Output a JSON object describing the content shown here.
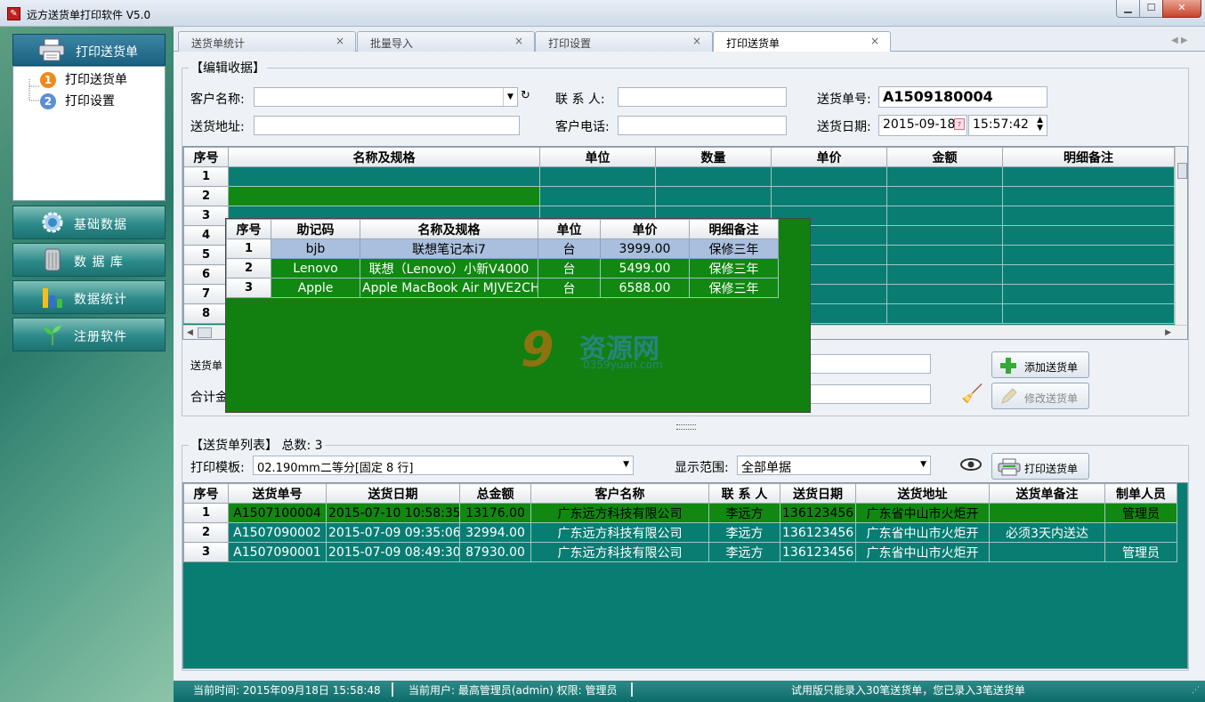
{
  "window": {
    "title": "远方送货单打印软件 V5.0",
    "icon": "app-icon"
  },
  "sidebar": {
    "header": {
      "label": "打印送货单",
      "icon": "printer-icon"
    },
    "tree": [
      {
        "num": "1",
        "label": "打印送货单",
        "color": "#f08a1c"
      },
      {
        "num": "2",
        "label": "打印设置",
        "color": "#5a8fd6"
      }
    ],
    "buttons": [
      {
        "label": "基础数据",
        "icon": "gear-icon"
      },
      {
        "label": "数 据 库",
        "icon": "database-icon"
      },
      {
        "label": "数据统计",
        "icon": "bar-chart-icon"
      },
      {
        "label": "注册软件",
        "icon": "sprout-icon"
      }
    ]
  },
  "tabs": [
    {
      "label": "送货单统计"
    },
    {
      "label": "批量导入"
    },
    {
      "label": "打印设置"
    },
    {
      "label": "打印送货单",
      "active": true
    }
  ],
  "edit": {
    "section_title": "【编辑收据】",
    "customer_label": "客户名称:",
    "customer_value": "",
    "contact_label": "联 系 人:",
    "contact_value": "",
    "order_no_label": "送货单号:",
    "order_no_value": "A1509180004",
    "address_label": "送货地址:",
    "address_value": "",
    "phone_label": "客户电话:",
    "phone_value": "",
    "date_label": "送货日期:",
    "date_value": "2015-09-18",
    "time_value": "15:57:42",
    "grid_headers": [
      "序号",
      "名称及规格",
      "单位",
      "数量",
      "单价",
      "金额",
      "明细备注"
    ],
    "grid_rows": [
      "1",
      "2",
      "3",
      "4",
      "5",
      "6",
      "7",
      "8"
    ],
    "order_note_label": "送货单",
    "total_label": "合计金",
    "add_button": "添加送货单",
    "edit_button": "修改送货单"
  },
  "popup": {
    "headers": [
      "序号",
      "助记码",
      "名称及规格",
      "单位",
      "单价",
      "明细备注"
    ],
    "rows": [
      [
        "1",
        "bjb",
        "联想笔记本i7",
        "台",
        "3999.00",
        "保修三年"
      ],
      [
        "2",
        "Lenovo",
        "联想（Lenovo）小新V4000",
        "台",
        "5499.00",
        "保修三年"
      ],
      [
        "3",
        "Apple",
        "Apple MacBook Air MJVE2CH",
        "台",
        "6588.00",
        "保修三年"
      ]
    ]
  },
  "list": {
    "section_title": "【送货单列表】 总数: 3",
    "template_label": "打印模板:",
    "template_value": "02.190mm二等分[固定 8 行]",
    "range_label": "显示范围:",
    "range_value": "全部单据",
    "print_button": "打印送货单",
    "headers": [
      "序号",
      "送货单号",
      "送货日期",
      "总金额",
      "客户名称",
      "联 系 人",
      "送货日期",
      "送货地址",
      "送货单备注",
      "制单人员"
    ],
    "rows": [
      [
        "1",
        "A1507100004",
        "2015-07-10 10:58:35",
        "13176.00",
        "广东远方科技有限公司",
        "李远方",
        "136123456",
        "广东省中山市火炬开",
        "",
        "管理员"
      ],
      [
        "2",
        "A1507090002",
        "2015-07-09 09:35:06",
        "32994.00",
        "广东远方科技有限公司",
        "李远方",
        "136123456",
        "广东省中山市火炬开",
        "必须3天内送达",
        ""
      ],
      [
        "3",
        "A1507090001",
        "2015-07-09 08:49:30",
        "87930.00",
        "广东远方科技有限公司",
        "李远方",
        "136123456",
        "广东省中山市火炬开",
        "",
        "管理员"
      ]
    ]
  },
  "status": {
    "time": "当前时间: 2015年09月18日 15:58:48",
    "user": "当前用户: 最高管理员(admin)  权限: 管理员",
    "trial": "试用版只能录入30笔送货单，您已录入3笔送货单"
  },
  "watermark": {
    "text": "资源网",
    "sub": "0359yuan.com"
  },
  "colors": {
    "grid_teal": "#0a7d73",
    "grid_green": "#118811",
    "selection": "#aabfdd"
  }
}
